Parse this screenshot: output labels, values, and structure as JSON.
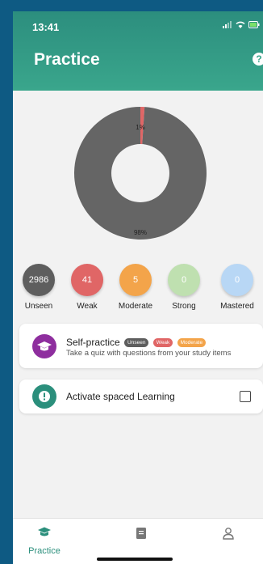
{
  "status_bar": {
    "time": "13:41"
  },
  "header": {
    "title": "Practice",
    "help_icon": "question-icon",
    "help_text": "?"
  },
  "chart_data": {
    "type": "pie",
    "style": "donut",
    "slices": [
      {
        "label": "Unseen",
        "value": 98,
        "display": "98%",
        "color": "#656565"
      },
      {
        "label": "Weak",
        "value": 1,
        "display": "1%",
        "color": "#e06666"
      }
    ]
  },
  "stats": [
    {
      "label": "Unseen",
      "count": "2986",
      "color": "#5e5e5e"
    },
    {
      "label": "Weak",
      "count": "41",
      "color": "#e06666"
    },
    {
      "label": "Moderate",
      "count": "5",
      "color": "#f3a44a"
    },
    {
      "label": "Strong",
      "count": "0",
      "color": "#bfe0b0"
    },
    {
      "label": "Mastered",
      "count": "0",
      "color": "#b8d7f5"
    }
  ],
  "self_practice": {
    "title": "Self-practice",
    "subtitle": "Take a quiz with questions from your study items",
    "icon": "graduation-cap-icon",
    "tags": [
      {
        "label": "Unseen",
        "color": "#5e5e5e"
      },
      {
        "label": "Weak",
        "color": "#e06666"
      },
      {
        "label": "Moderate",
        "color": "#f3a44a"
      }
    ]
  },
  "spaced_learning": {
    "label": "Activate spaced Learning",
    "icon": "exclamation-icon",
    "checked": false
  },
  "tabbar": {
    "practice_label": "Practice"
  }
}
